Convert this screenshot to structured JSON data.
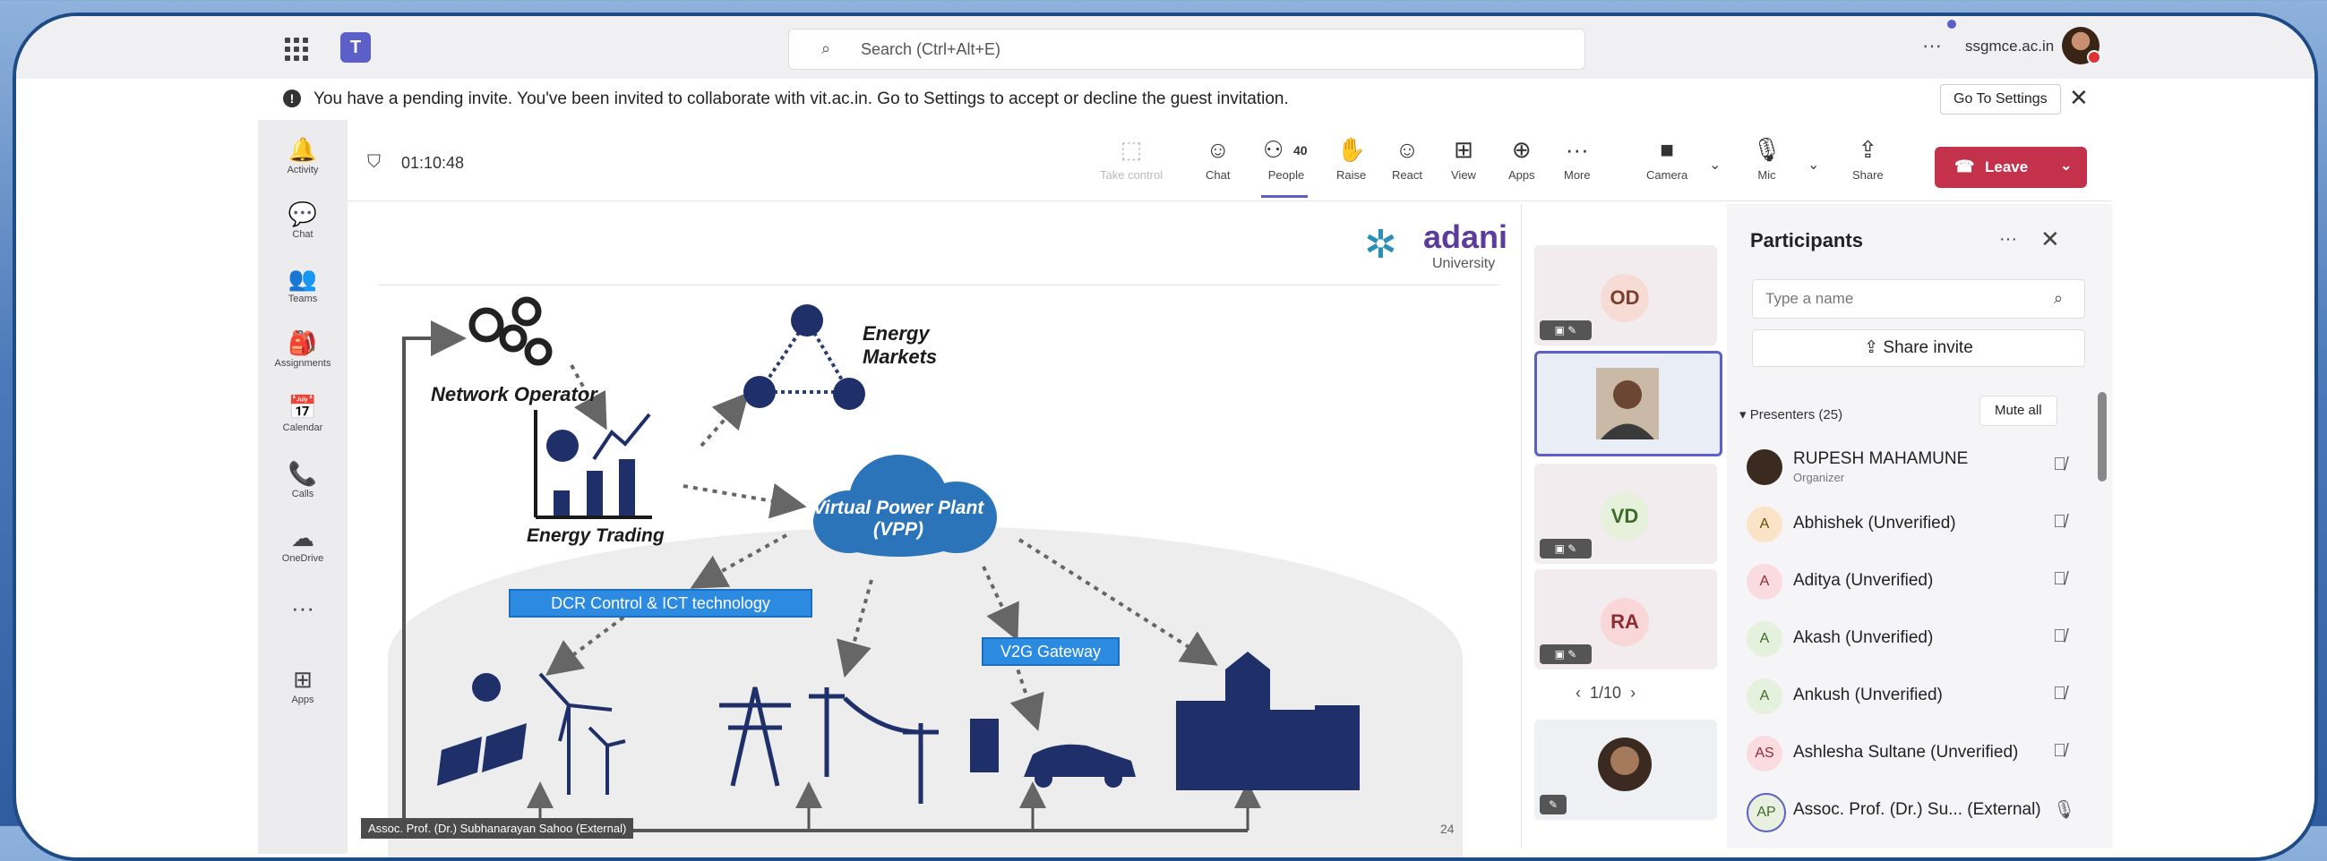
{
  "topbar": {
    "search_placeholder": "Search (Ctrl+Alt+E)",
    "more": "···",
    "org": "ssgmce.ac.in"
  },
  "banner": {
    "text": "You have a pending invite. You've been invited to collaborate with vit.ac.in. Go to Settings to accept or decline the guest invitation.",
    "button": "Go To Settings",
    "close": "✕"
  },
  "rail": [
    {
      "label": "Activity",
      "icon": "bell-icon",
      "glyph": "🔔"
    },
    {
      "label": "Chat",
      "icon": "chat-icon",
      "glyph": "💬"
    },
    {
      "label": "Teams",
      "icon": "teams-icon",
      "glyph": "👥"
    },
    {
      "label": "Assignments",
      "icon": "assignments-icon",
      "glyph": "🎒"
    },
    {
      "label": "Calendar",
      "icon": "calendar-icon",
      "glyph": "📅"
    },
    {
      "label": "Calls",
      "icon": "phone-icon",
      "glyph": "📞"
    },
    {
      "label": "OneDrive",
      "icon": "cloud-icon",
      "glyph": "☁"
    },
    {
      "label": "",
      "icon": "more-icon",
      "glyph": "···"
    },
    {
      "label": "Apps",
      "icon": "apps-icon",
      "glyph": "⊞"
    }
  ],
  "meeting": {
    "timer": "01:10:48",
    "tools": {
      "take_control": "Take control",
      "chat": "Chat",
      "people": "People",
      "people_count": "40",
      "raise": "Raise",
      "react": "React",
      "view": "View",
      "apps": "Apps",
      "more": "More",
      "camera": "Camera",
      "mic": "Mic",
      "share": "Share",
      "leave": "Leave"
    }
  },
  "slide": {
    "logo_name": "adani",
    "logo_sub": "University",
    "network_operator": "Network Operator",
    "energy_markets": "Energy Markets",
    "energy_trading": "Energy Trading",
    "vpp": "Virtual Power Plant (VPP)",
    "dcr": "DCR Control & ICT technology",
    "v2g": "V2G Gateway",
    "presenter_caption": "Assoc. Prof. (Dr.) Subhanarayan Sahoo (External)",
    "page_number": "24"
  },
  "tiles": {
    "items": [
      {
        "initials": "OD"
      },
      {
        "initials": ""
      },
      {
        "initials": "VD"
      },
      {
        "initials": "RA"
      }
    ],
    "pager": "1/10"
  },
  "participants": {
    "title": "Participants",
    "more": "···",
    "close": "✕",
    "search_placeholder": "Type a name",
    "share_invite": "Share invite",
    "presenters_label": "Presenters (25)",
    "mute_all": "Mute all",
    "list": [
      {
        "name": "RUPESH MAHAMUNE",
        "role": "Organizer",
        "initials": "",
        "color": "#3a2a20"
      },
      {
        "name": "Abhishek (Unverified)",
        "role": "",
        "initials": "A",
        "color": "#fbe3c8"
      },
      {
        "name": "Aditya (Unverified)",
        "role": "",
        "initials": "A",
        "color": "#fadbe0"
      },
      {
        "name": "Akash (Unverified)",
        "role": "",
        "initials": "A",
        "color": "#e4f1dc"
      },
      {
        "name": "Ankush (Unverified)",
        "role": "",
        "initials": "A",
        "color": "#e4f1dc"
      },
      {
        "name": "Ashlesha Sultane (Unverified)",
        "role": "",
        "initials": "AS",
        "color": "#fadbe0"
      },
      {
        "name": "Assoc. Prof. (Dr.) Su... (External)",
        "role": "",
        "initials": "AP",
        "color": "#e8f1e0"
      }
    ]
  }
}
